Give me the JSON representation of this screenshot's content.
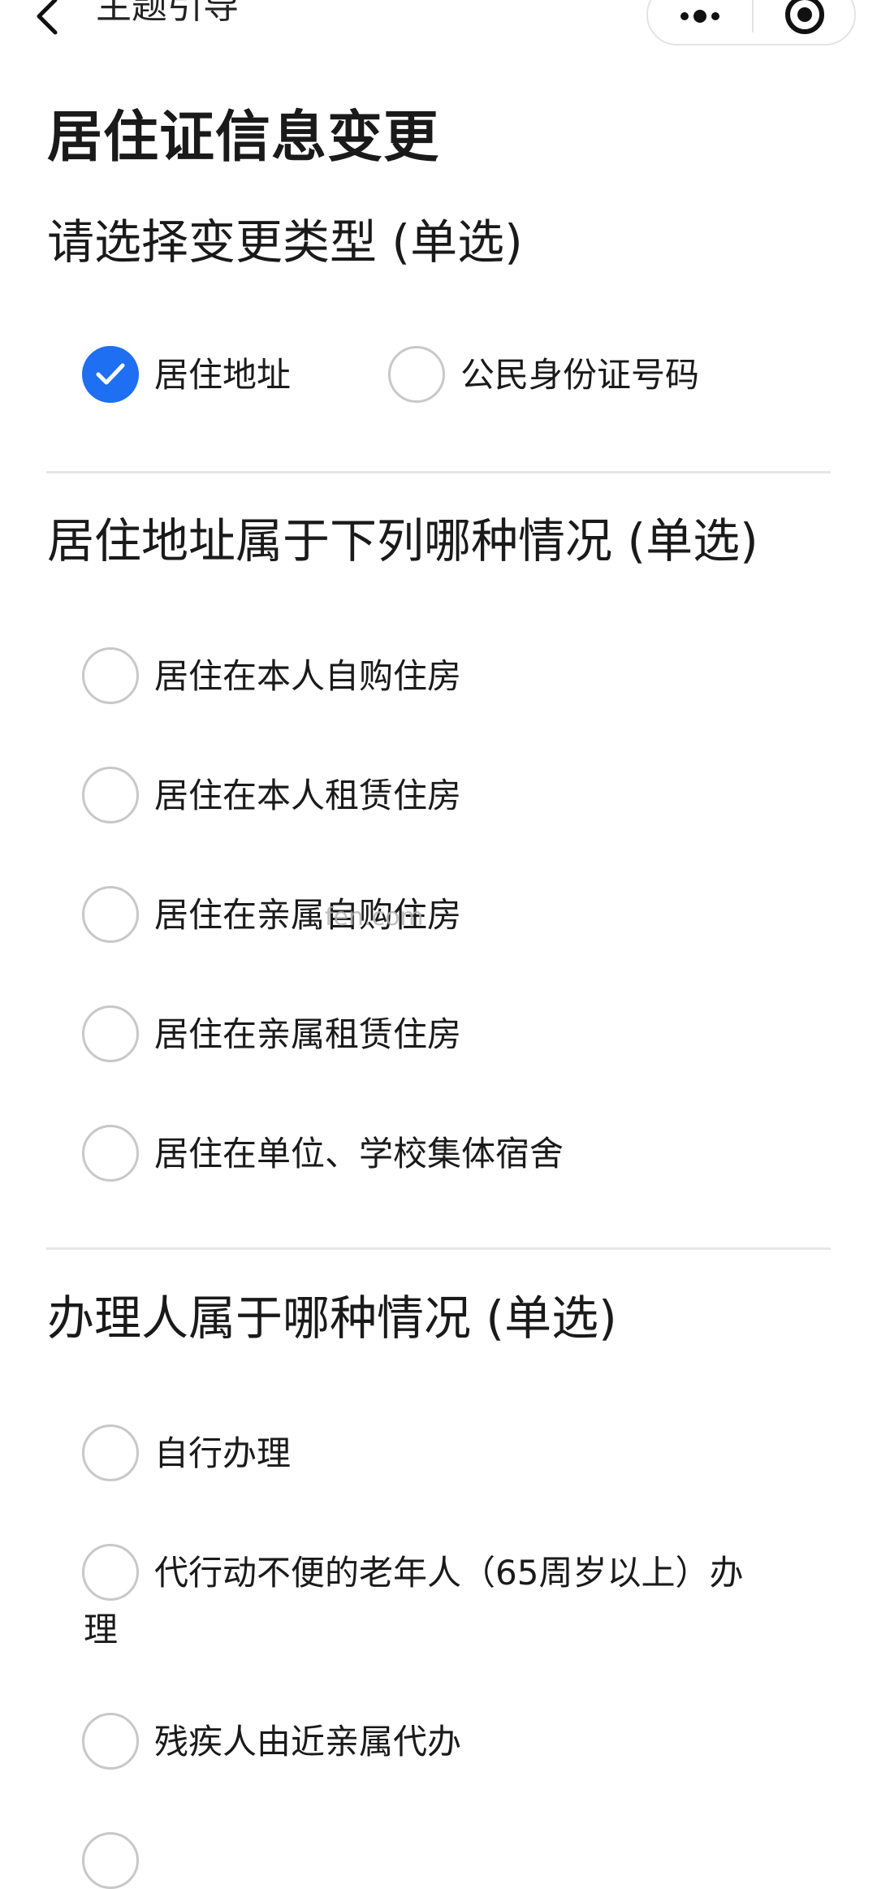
{
  "navbar": {
    "title": "主题引导"
  },
  "page_title": "居住证信息变更",
  "sections": [
    {
      "title": "请选择变更类型 (单选)",
      "options": [
        {
          "label": "居住地址",
          "checked": true
        },
        {
          "label": "公民身份证号码",
          "checked": false
        }
      ]
    },
    {
      "title": "居住地址属于下列哪种情况 (单选)",
      "options": [
        {
          "label": "居住在本人自购住房",
          "checked": false
        },
        {
          "label": "居住在本人租赁住房",
          "checked": false
        },
        {
          "label": "居住在亲属自购住房",
          "checked": false
        },
        {
          "label": "居住在亲属租赁住房",
          "checked": false
        },
        {
          "label": "居住在单位、学校集体宿舍",
          "checked": false
        }
      ]
    },
    {
      "title": "办理人属于哪种情况 (单选)",
      "options": [
        {
          "label": "自行办理",
          "checked": false
        },
        {
          "label": "代行动不便的老年人（65周岁以上）办理",
          "checked": false
        },
        {
          "label": "残疾人由近亲属代办",
          "checked": false
        }
      ]
    }
  ],
  "watermark": "fen.com",
  "colors": {
    "accent": "#1e6ff1",
    "divider": "#e6e6e6",
    "radio_border": "#c8c8c8"
  }
}
